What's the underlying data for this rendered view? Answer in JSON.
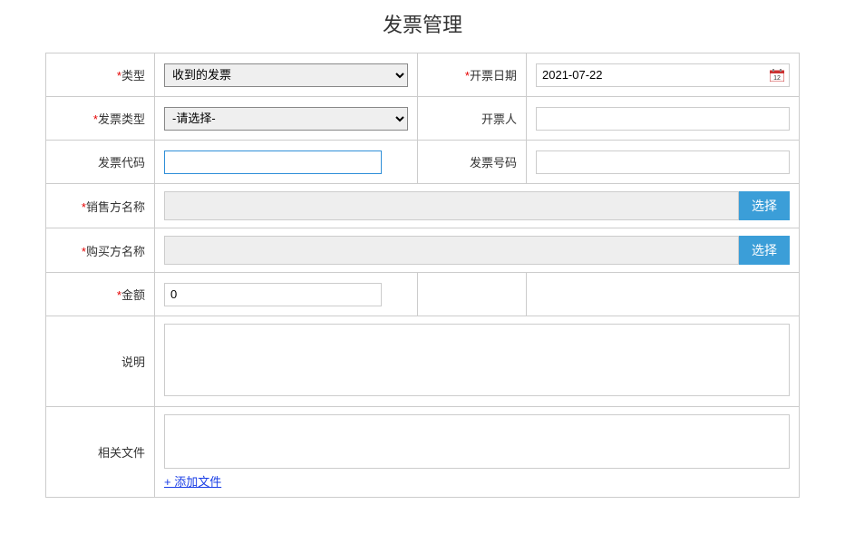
{
  "page_title": "发票管理",
  "labels": {
    "type": "类型",
    "invoice_date": "开票日期",
    "invoice_kind": "发票类型",
    "issuer": "开票人",
    "invoice_code": "发票代码",
    "invoice_number": "发票号码",
    "seller_name": "销售方名称",
    "buyer_name": "购买方名称",
    "amount": "金额",
    "description": "说明",
    "related_files": "相关文件"
  },
  "values": {
    "type": "收到的发票",
    "invoice_date": "2021-07-22",
    "invoice_kind": "-请选择-",
    "issuer": "",
    "invoice_code": "",
    "invoice_number": "",
    "seller_name": "",
    "buyer_name": "",
    "amount": "0",
    "description": ""
  },
  "buttons": {
    "select": "选择",
    "add_file": "+ 添加文件"
  },
  "required_marker": "*"
}
